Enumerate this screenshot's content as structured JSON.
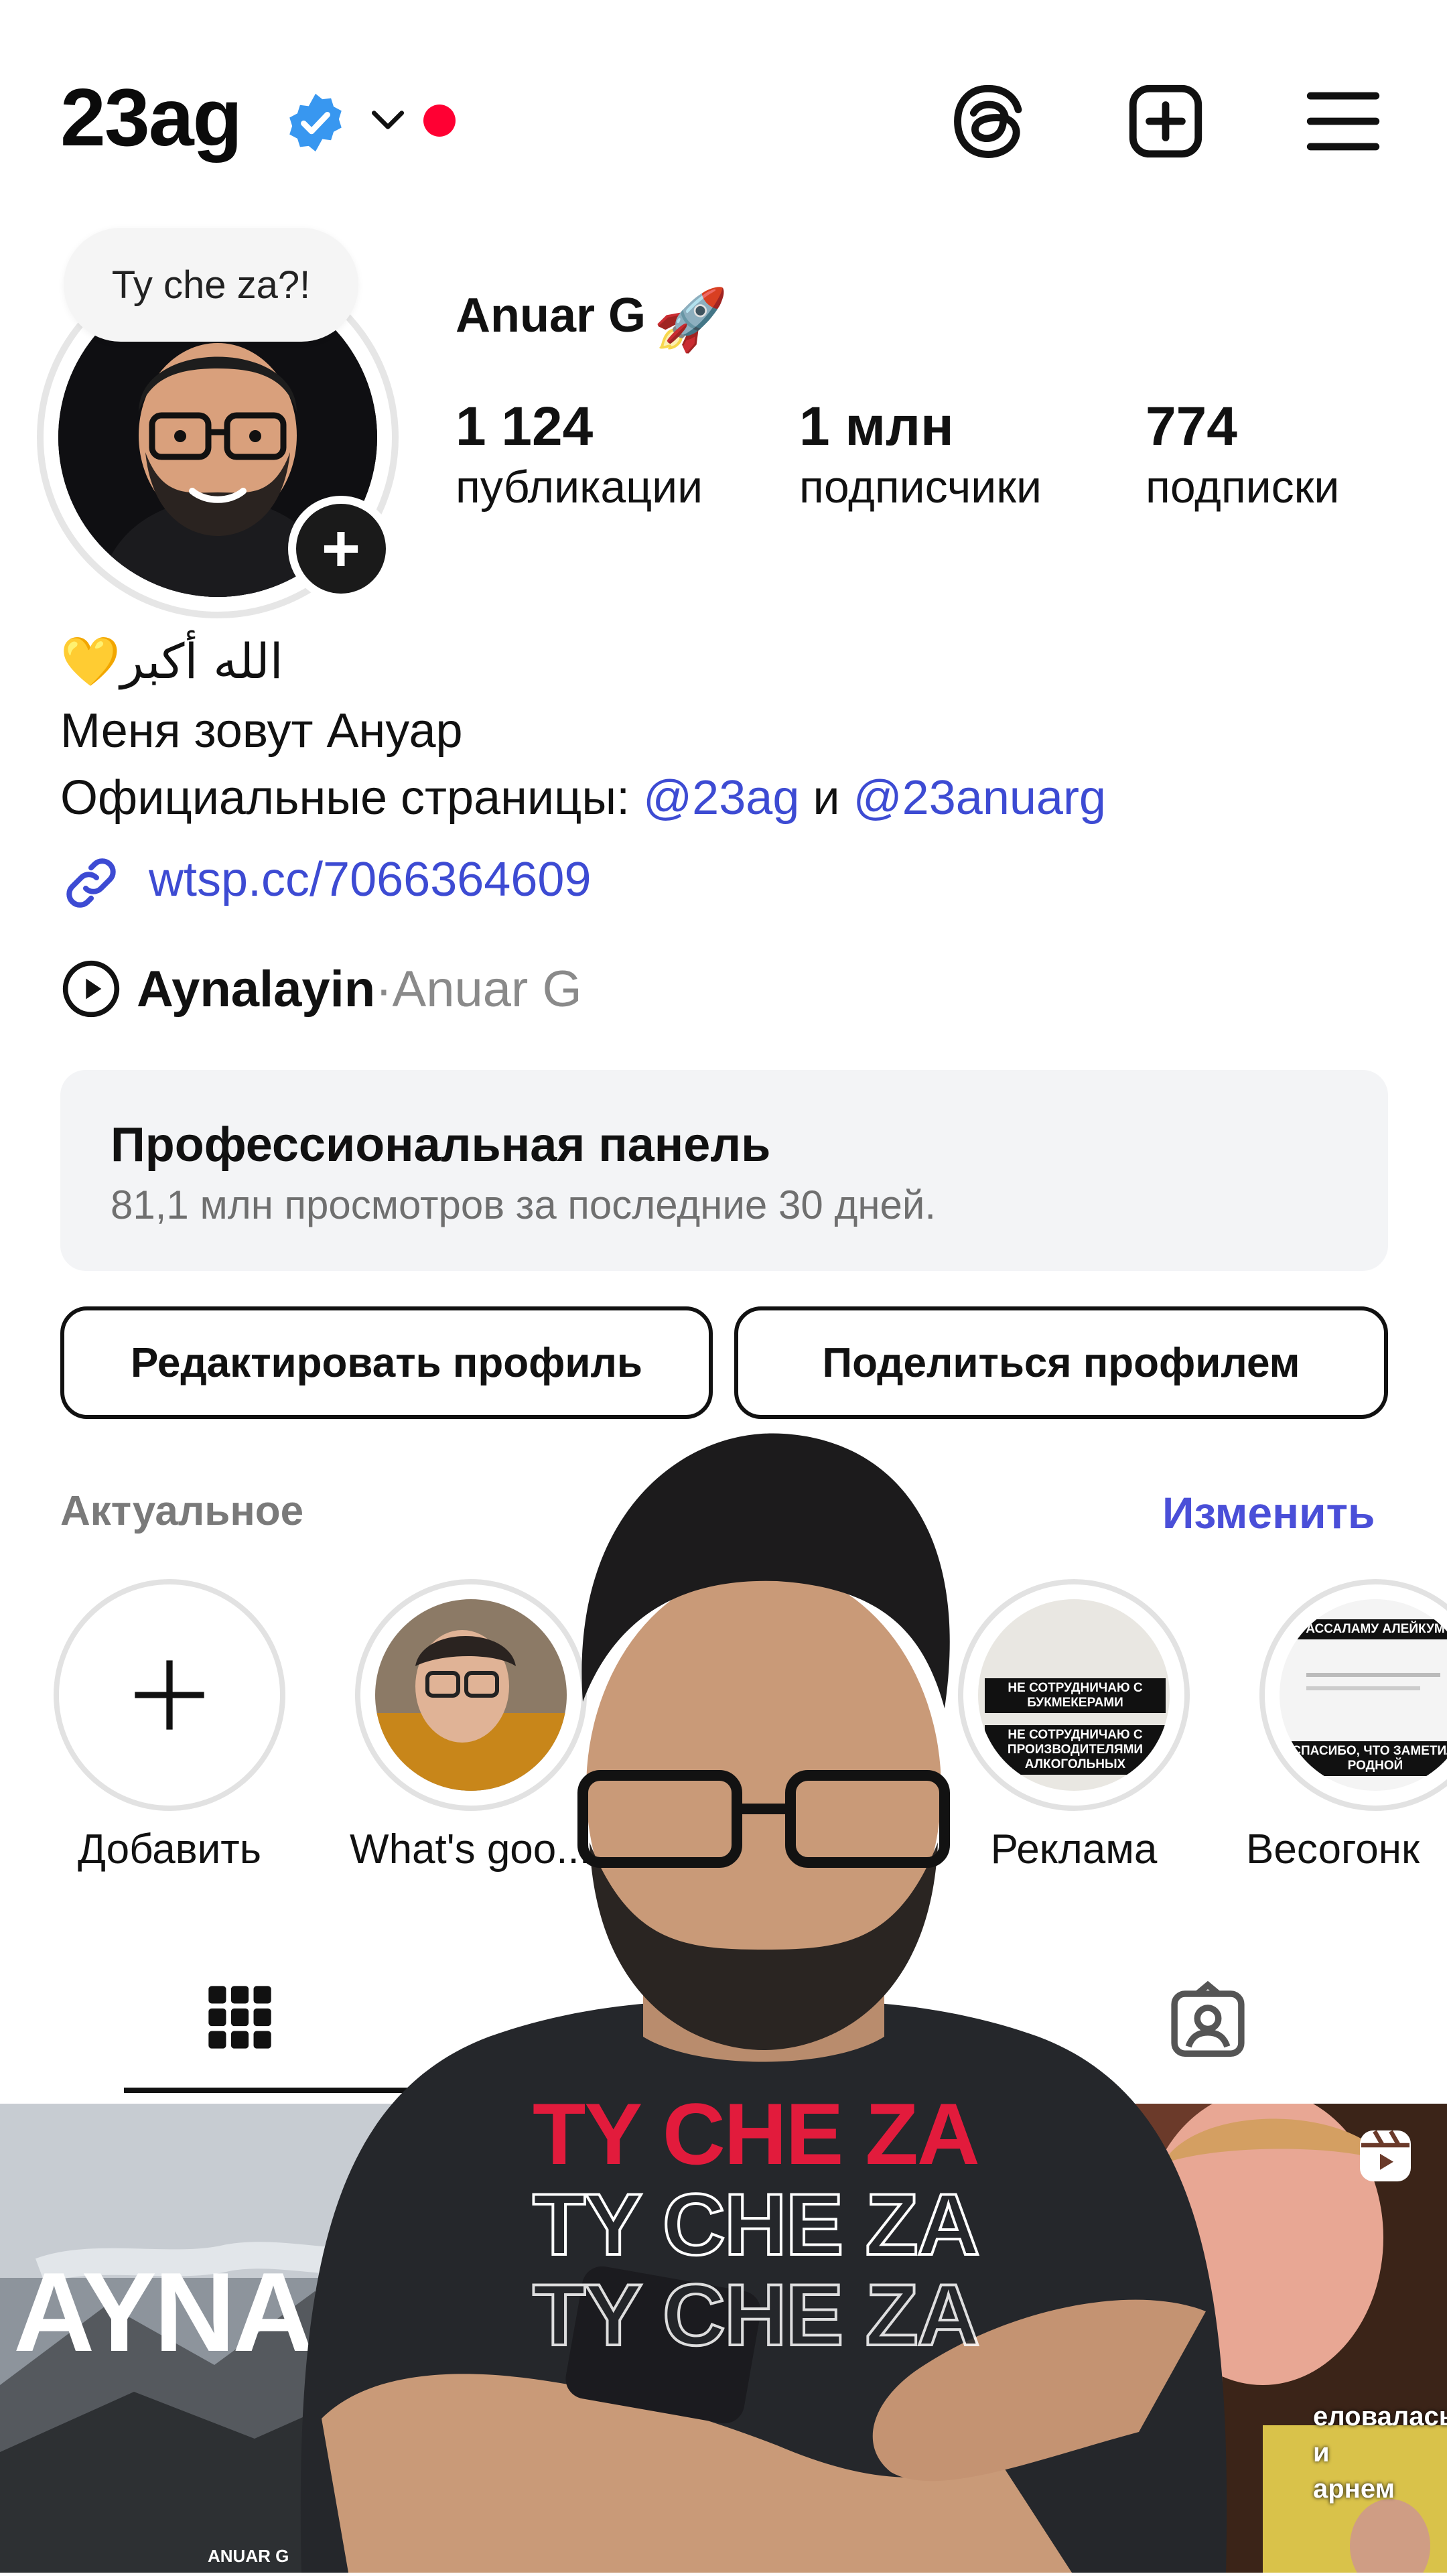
{
  "header": {
    "username": "23ag",
    "icons": [
      "verified-badge-icon",
      "chevron-down-icon",
      "notification-dot",
      "threads-icon",
      "create-post-icon",
      "menu-icon"
    ]
  },
  "avatar": {
    "note_text": "Ty che za?!"
  },
  "profile": {
    "display_name": "Anuar G",
    "display_name_emoji": "🚀",
    "stats": [
      {
        "value": "1 124",
        "label": "публикации"
      },
      {
        "value": "1 млн",
        "label": "подписчики"
      },
      {
        "value": "774",
        "label": "подписки"
      }
    ]
  },
  "bio": {
    "line1_emoji": "💛",
    "line1_text": "الله أكبر",
    "line2": "Меня зовут Ануар",
    "line3_prefix": "Официальные страницы: ",
    "mention1": "@23ag",
    "line3_and": " и ",
    "mention2": "@23anuarg",
    "link": "wtsp.cc/7066364609"
  },
  "music": {
    "title": "Aynalayin",
    "separator": " · ",
    "artist": "Anuar G"
  },
  "dashboard": {
    "title": "Профессиональная панель",
    "subtitle": "81,1 млн просмотров за последние 30 дней."
  },
  "buttons": {
    "edit_profile": "Редактировать профиль",
    "share_profile": "Поделиться профилем"
  },
  "highlights": {
    "title": "Актуальное",
    "edit": "Изменить",
    "items": [
      {
        "label": "Добавить"
      },
      {
        "label": "What's goo..."
      },
      {
        "label": "Реклама"
      },
      {
        "label": "Весогонк"
      }
    ],
    "story_texts": {
      "ads1": "НЕ СОТРУДНИЧАЮ С БУКМЕКЕРАМИ",
      "ads2": "НЕ СОТРУДНИЧАЮ С ПРОИЗВОДИТЕЛЯМИ АЛКОГОЛЬНЫХ",
      "weight1": "АССАЛАМУ АЛЕЙКУМ",
      "weight2": "СПАСИБО, ЧТО ЗАМЕТИЛ, РОДНОЙ"
    }
  },
  "grid": {
    "post1_title": "AYNALA",
    "post1_author": "ANUAR G",
    "post3_caption": "еловалась\nи\nарнем"
  },
  "overlay": {
    "shirt_lines": [
      "TY CHE ZA",
      "TY CHE ZA",
      "TY CHE ZA"
    ]
  },
  "colors": {
    "accent_blue": "#3d4bd3",
    "verified": "#3897f0",
    "shirt_red": "#e21b3c"
  }
}
